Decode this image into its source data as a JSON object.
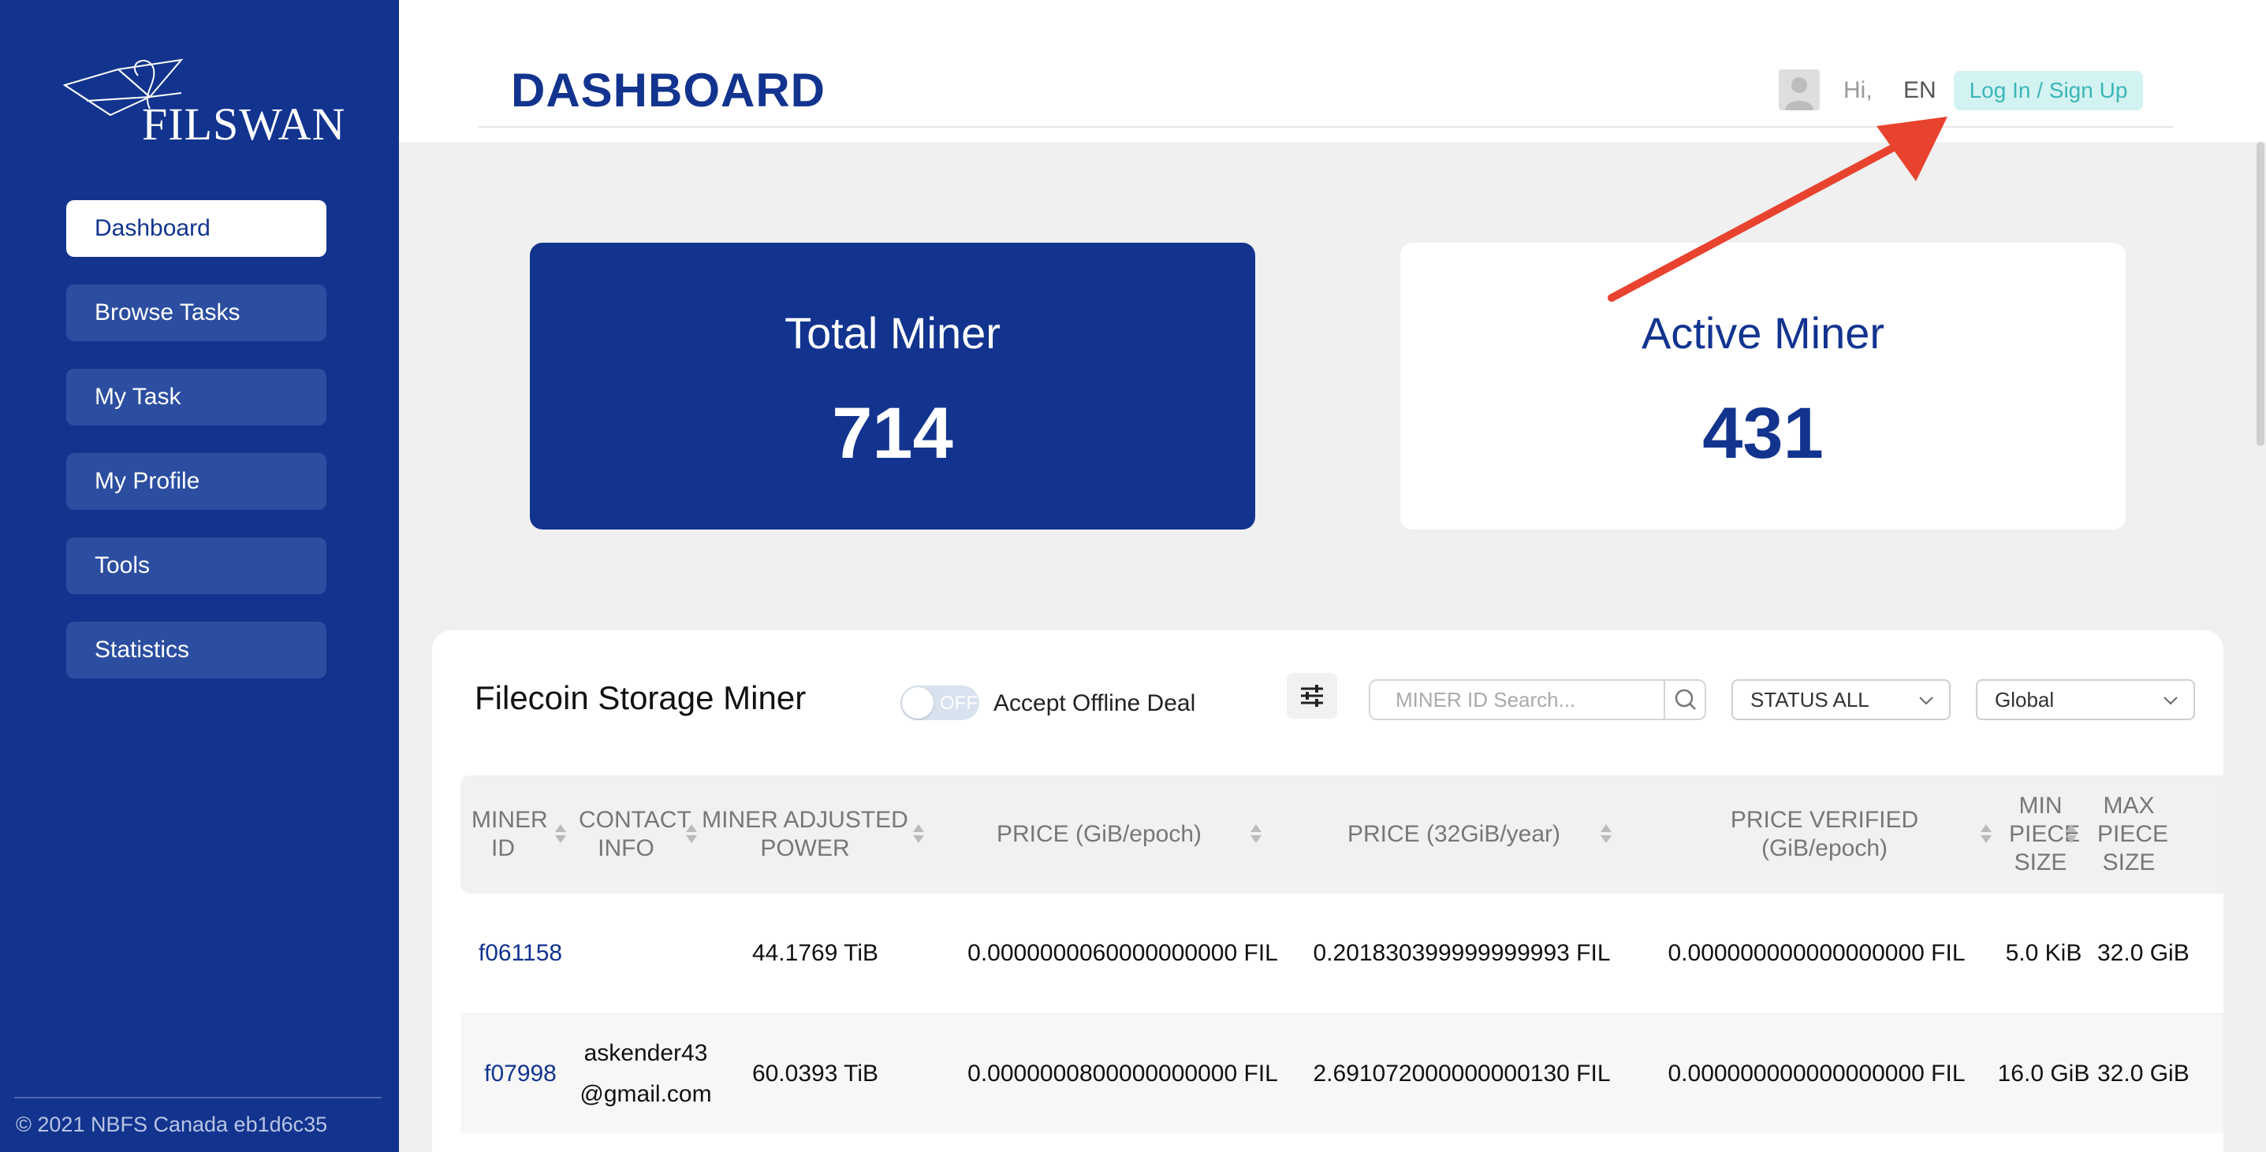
{
  "brand": {
    "name": "FILSWAN"
  },
  "sidebar": {
    "items": [
      {
        "label": "Dashboard",
        "active": true
      },
      {
        "label": "Browse Tasks"
      },
      {
        "label": "My Task"
      },
      {
        "label": "My Profile"
      },
      {
        "label": "Tools"
      },
      {
        "label": "Statistics"
      }
    ],
    "copyright": "© 2021 NBFS Canada eb1d6c35"
  },
  "header": {
    "title": "DASHBOARD",
    "greeting": "Hi,",
    "language": "EN",
    "login_label": "Log In / Sign Up"
  },
  "cards": {
    "total": {
      "label": "Total Miner",
      "value": "714"
    },
    "active": {
      "label": "Active Miner",
      "value": "431"
    }
  },
  "miners": {
    "title": "Filecoin Storage Miner",
    "toggle_state": "OFF",
    "toggle_label": "Accept Offline Deal",
    "search_placeholder": "MINER ID Search...",
    "status_select": "STATUS ALL",
    "region_select": "Global",
    "columns": [
      {
        "label": "MINER ID"
      },
      {
        "label": "CONTACT INFO"
      },
      {
        "label": "MINER ADJUSTED POWER"
      },
      {
        "label": "PRICE (GiB/epoch)"
      },
      {
        "label": "PRICE (32GiB/year)"
      },
      {
        "label": "PRICE VERIFIED (GiB/epoch)"
      },
      {
        "label": "MIN PIECE SIZE"
      },
      {
        "label": "MAX PIECE SIZE"
      }
    ],
    "rows": [
      {
        "miner_id": "f061158",
        "contact": "",
        "power": "44.1769 TiB",
        "price_epoch": "0.0000000060000000000 FIL",
        "price_year": "0.201830399999999993 FIL",
        "price_verified": "0.000000000000000000 FIL",
        "min_piece": "5.0 KiB",
        "max_piece": "32.0 GiB"
      },
      {
        "miner_id": "f07998",
        "contact": "askender43\n@gmail.com",
        "power": "60.0393 TiB",
        "price_epoch": "0.0000000800000000000 FIL",
        "price_year": "2.691072000000000130 FIL",
        "price_verified": "0.000000000000000000 FIL",
        "min_piece": "16.0 GiB",
        "max_piece": "32.0 GiB"
      }
    ]
  },
  "colors": {
    "brand_blue": "#12348f",
    "teal": "#3bb6b7",
    "arrow_red": "#e8432f"
  }
}
